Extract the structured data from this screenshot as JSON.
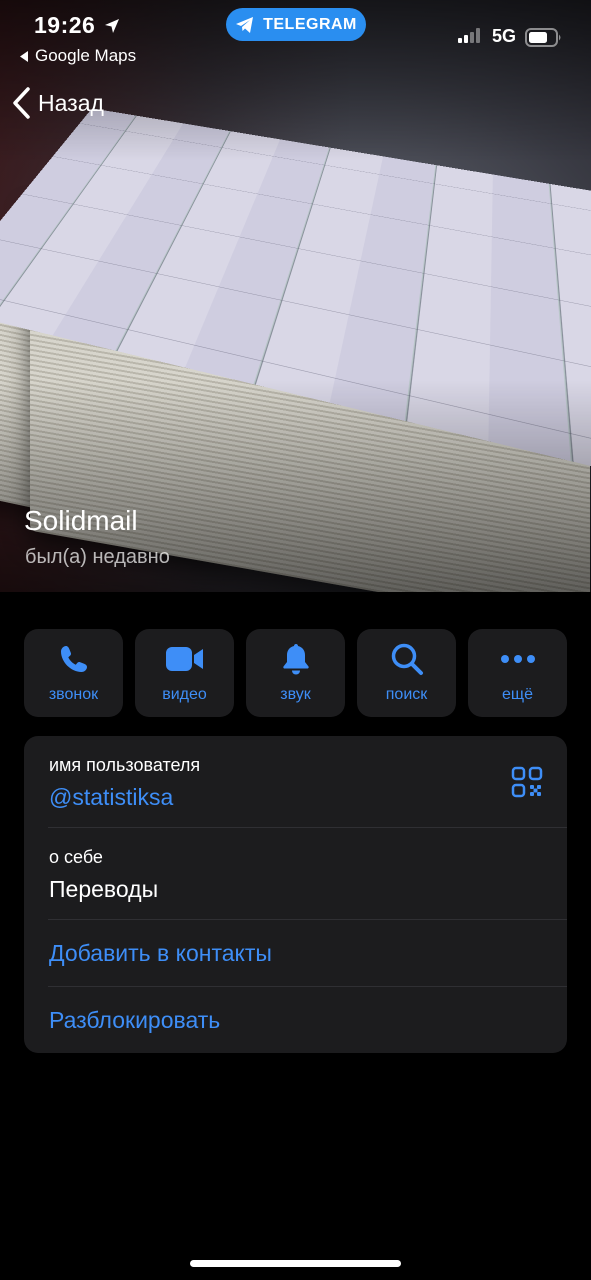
{
  "status_bar": {
    "time": "19:26",
    "back_app": "Google Maps",
    "app_pill": "TELEGRAM",
    "network": "5G"
  },
  "nav": {
    "back_label": "Назад"
  },
  "profile": {
    "name": "Solidmail",
    "status": "был(а) недавно"
  },
  "actions": [
    {
      "label": "звонок",
      "icon": "phone-icon"
    },
    {
      "label": "видео",
      "icon": "video-camera-icon"
    },
    {
      "label": "звук",
      "icon": "bell-icon"
    },
    {
      "label": "поиск",
      "icon": "search-icon"
    },
    {
      "label": "ещё",
      "icon": "more-dots-icon"
    }
  ],
  "info": {
    "username_caption": "имя пользователя",
    "username_value": "@statistiksa",
    "about_caption": "о себе",
    "about_value": "Переводы",
    "add_contact": "Добавить в контакты",
    "unblock": "Разблокировать"
  },
  "colors": {
    "accent": "#3e8ef7",
    "card": "#1c1c1e",
    "background": "#000000",
    "telegram_pill": "#2a8ef0"
  }
}
